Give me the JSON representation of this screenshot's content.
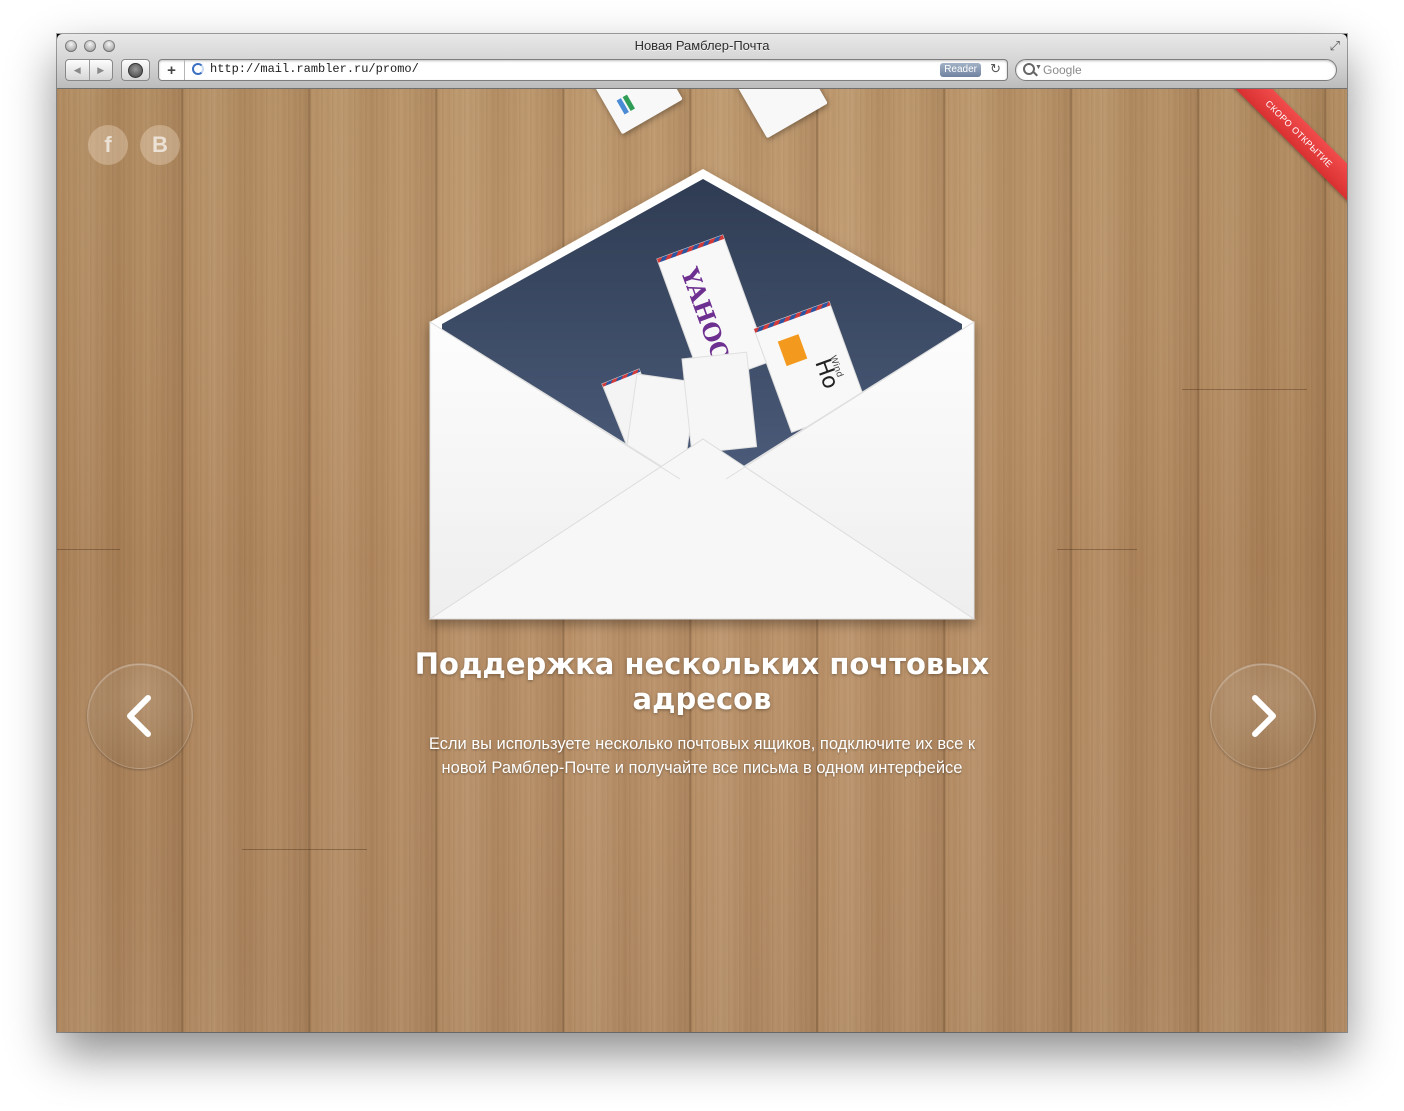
{
  "window": {
    "title": "Новая Рамблер-Почта"
  },
  "toolbar": {
    "add_label": "+",
    "url": "http://mail.rambler.ru/promo/",
    "reader_label": "Reader",
    "search_placeholder": "Google"
  },
  "page": {
    "social": {
      "facebook_label": "f",
      "vk_label": "B"
    },
    "ribbon_text": "СКОРО ОТКРЫТИЕ",
    "cards": {
      "yahoo_logo": "YAHOO!",
      "hotmail_logo": "Ho",
      "hotmail_small": "Wind"
    },
    "headline": "Поддержка нескольких почтовых адресов",
    "description": "Если вы используете несколько почтовых ящиков, подключите их все к новой Рамблер-Почте и  получайте все письма в одном интерфейсе",
    "nav": {
      "prev_icon": "chevron-left-icon",
      "next_icon": "chevron-right-icon"
    }
  },
  "colors": {
    "ribbon": "#e53a3a",
    "envelope_inner": "#3a4a66",
    "wood": "#b8895a",
    "yahoo_purple": "#6d2f90",
    "hotmail_orange": "#f39a1e"
  }
}
